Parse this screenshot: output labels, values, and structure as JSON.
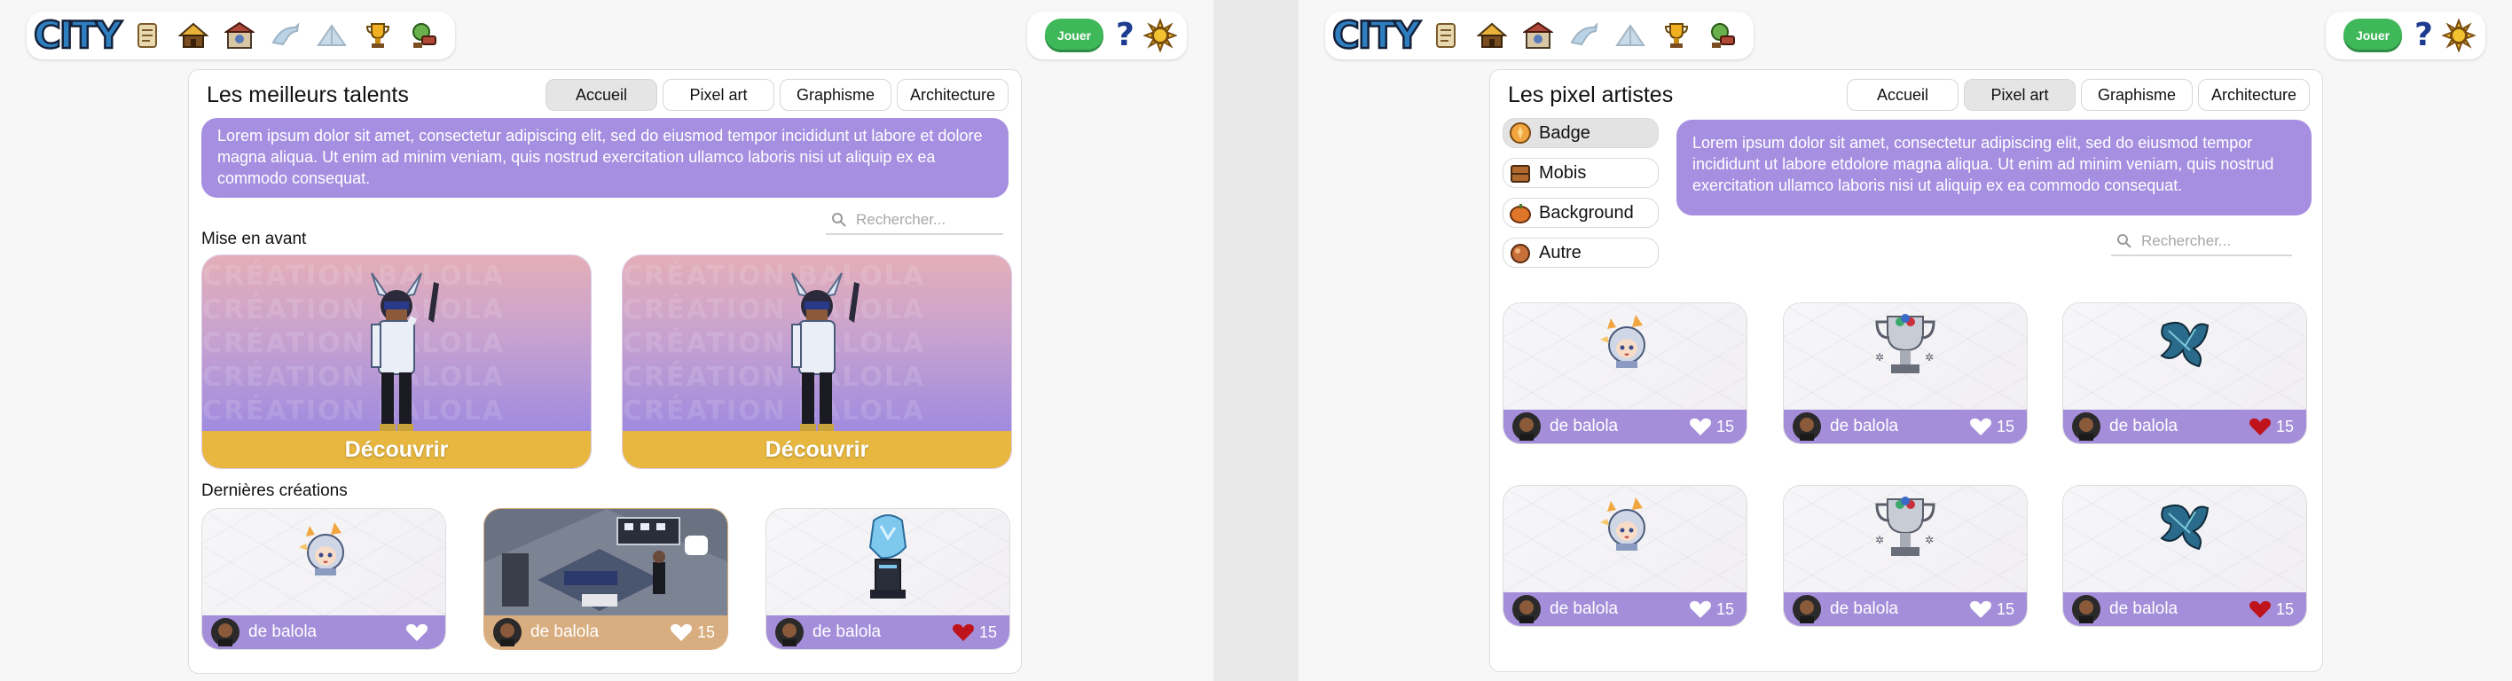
{
  "nav": {
    "logo": "CITY",
    "icons": [
      "scroll-icon",
      "house-icon",
      "shop-icon",
      "dolphin-icon",
      "pyramid-icon",
      "trophy-icon",
      "tools-icon"
    ],
    "play_label": "Jouer",
    "help_label": "?"
  },
  "screen1": {
    "title": "Les meilleurs talents",
    "tabs": [
      "Accueil",
      "Pixel art",
      "Graphisme",
      "Architecture"
    ],
    "active_tab": "Accueil",
    "intro": "Lorem ipsum dolor sit amet, consectetur adipiscing elit, sed do eiusmod tempor incididunt ut labore et dolore magna aliqua. Ut enim ad minim veniam, quis nostrud exercitation ullamco laboris nisi ut aliquip ex ea commodo consequat.",
    "search_placeholder": "Rechercher...",
    "featured_title": "Mise en avant",
    "featured": [
      {
        "background_word": "CRÉATION BALOLA",
        "button": "Découvrir"
      },
      {
        "background_word": "CRÉATION BALOLA",
        "button": "Découvrir"
      }
    ],
    "latest_title": "Dernières créations",
    "latest": [
      {
        "author": "de balola",
        "likes": "",
        "liked": false,
        "art": "badge-girl"
      },
      {
        "author": "de balola",
        "likes": "15",
        "liked": false,
        "art": "room"
      },
      {
        "author": "de balola",
        "likes": "15",
        "liked": true,
        "art": "ice-statue"
      }
    ]
  },
  "screen2": {
    "title": "Les pixel artistes",
    "tabs": [
      "Accueil",
      "Pixel art",
      "Graphisme",
      "Architecture"
    ],
    "active_tab": "Pixel art",
    "filters": [
      {
        "label": "Badge",
        "icon": "badge-icon",
        "active": true
      },
      {
        "label": "Mobis",
        "icon": "crate-icon",
        "active": false
      },
      {
        "label": "Background",
        "icon": "pumpkin-icon",
        "active": false
      },
      {
        "label": "Autre",
        "icon": "orb-icon",
        "active": false
      }
    ],
    "intro": "Lorem ipsum dolor sit amet, consectetur adipiscing elit, sed do eiusmod tempor incididunt ut labore etdolore magna aliqua. Ut enim ad minim veniam, quis nostrud exercitation ullamco laboris nisi ut aliquip ex ea commodo consequat.",
    "search_placeholder": "Rechercher...",
    "grid": [
      {
        "author": "de balola",
        "likes": "15",
        "liked": false,
        "art": "badge-girl"
      },
      {
        "author": "de balola",
        "likes": "15",
        "liked": false,
        "art": "trophy"
      },
      {
        "author": "de balola",
        "likes": "15",
        "liked": true,
        "art": "leaf"
      },
      {
        "author": "de balola",
        "likes": "15",
        "liked": false,
        "art": "badge-girl"
      },
      {
        "author": "de balola",
        "likes": "15",
        "liked": false,
        "art": "trophy"
      },
      {
        "author": "de balola",
        "likes": "15",
        "liked": true,
        "art": "leaf"
      }
    ]
  },
  "colors": {
    "accent_purple": "#a68fe0",
    "card_footer": "#a48dd9",
    "featured_button": "#e7b740",
    "play_green": "#3fb85a",
    "liked_heart": "#c0141c"
  }
}
